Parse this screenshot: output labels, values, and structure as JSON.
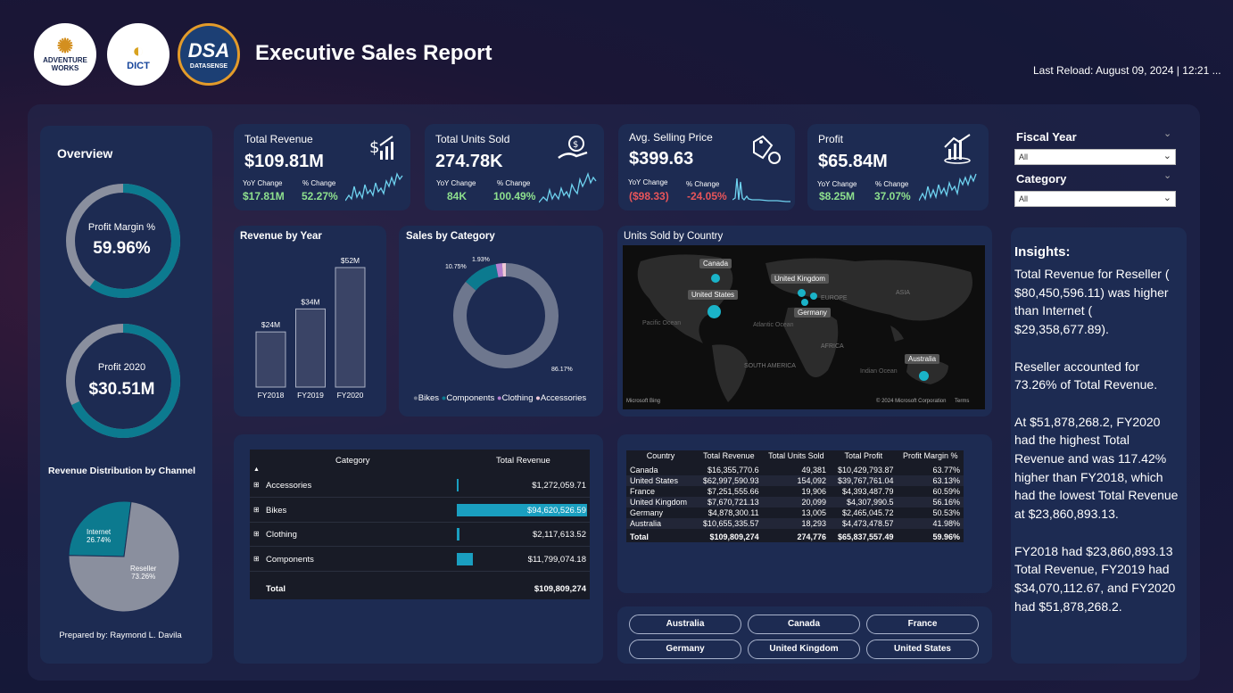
{
  "header": {
    "title": "Executive Sales Report",
    "last_reload": "Last Reload: August 09, 2024 | 12:21 ...",
    "logos": [
      {
        "name": "ADVENTURE WORKS",
        "line1": "ADVENTURE",
        "line2": "WORKS"
      },
      {
        "name": "DICT",
        "text": "DICT"
      },
      {
        "name": "DATASENSE",
        "big": "DSA",
        "small": "DATASENSE"
      }
    ]
  },
  "overview": {
    "title": "Overview",
    "profit_margin": {
      "label": "Profit Margin %",
      "value": "59.96%",
      "fraction": 0.5996
    },
    "profit_2020": {
      "label": "Profit 2020",
      "value": "$30.51M",
      "fraction": 0.68
    },
    "channel_title": "Revenue Distribution by Channel",
    "channels": [
      {
        "name": "Internet",
        "pct": "26.74%",
        "value": 26.74
      },
      {
        "name": "Reseller",
        "pct": "73.26%",
        "value": 73.26
      }
    ],
    "prepared_by": "Prepared by: Raymond L. Davila"
  },
  "kpis": [
    {
      "title": "Total Revenue",
      "value": "$109.81M",
      "sub1": "YoY Change",
      "sub2": "% Change",
      "num1": "$17.81M",
      "num2": "52.27%",
      "tone": "green",
      "icon": "revenue-icon"
    },
    {
      "title": "Total Units Sold",
      "value": "274.78K",
      "sub1": "YoY Change",
      "sub2": "% Change",
      "num1": "84K",
      "num2": "100.49%",
      "tone": "green",
      "icon": "units-icon"
    },
    {
      "title": "Avg. Selling Price",
      "value": "$399.63",
      "sub1": "YoY Change",
      "sub2": "% Change",
      "num1": "($98.33)",
      "num2": "-24.05%",
      "tone": "red",
      "icon": "price-tag-icon"
    },
    {
      "title": "Profit",
      "value": "$65.84M",
      "sub1": "YoY Change",
      "sub2": "% Change",
      "num1": "$8.25M",
      "num2": "37.07%",
      "tone": "green",
      "icon": "profit-icon"
    }
  ],
  "filters": {
    "fiscal_year": {
      "label": "Fiscal Year",
      "value": "All"
    },
    "category": {
      "label": "Category",
      "value": "All"
    }
  },
  "revenue_by_year": {
    "title": "Revenue by Year",
    "bars": [
      {
        "year": "FY2018",
        "label": "$24M",
        "value": 24
      },
      {
        "year": "FY2019",
        "label": "$34M",
        "value": 34
      },
      {
        "year": "FY2020",
        "label": "$52M",
        "value": 52
      }
    ]
  },
  "sales_by_category": {
    "title": "Sales by Category",
    "slices": [
      {
        "name": "Bikes",
        "value": 86.17,
        "label": "86.17%",
        "color": "#6e778e"
      },
      {
        "name": "Components",
        "value": 10.75,
        "label": "10.75%",
        "color": "#0c7a8f"
      },
      {
        "name": "Clothing",
        "value": 1.93,
        "label": "1.93%",
        "color": "#b57fcf"
      },
      {
        "name": "Accessories",
        "value": 1.15,
        "label": "",
        "color": "#f0c9d7"
      }
    ]
  },
  "map": {
    "title": "Units Sold by Country",
    "labels": {
      "canada": "Canada",
      "united_states": "United States",
      "united_kingdom": "United Kingdom",
      "germany": "Germany",
      "australia": "Australia",
      "europe": "EUROPE",
      "asia": "ASIA",
      "africa": "AFRICA",
      "south_america": "SOUTH AMERICA",
      "pacific": "Pacific Ocean",
      "atlantic": "Atlantic Ocean",
      "indian": "Indian Ocean"
    },
    "credit_left": "Microsoft Bing",
    "credit_right": "© 2024 Microsoft Corporation",
    "terms": "Terms"
  },
  "category_table": {
    "sort_indicator": "▲",
    "headers": [
      "Category",
      "Total Revenue"
    ],
    "rows": [
      {
        "name": "Accessories",
        "value": "$1,272,059.71",
        "share": 0.01344
      },
      {
        "name": "Bikes",
        "value": "$94,620,526.59",
        "share": 1.0
      },
      {
        "name": "Clothing",
        "value": "$2,117,613.52",
        "share": 0.02238
      },
      {
        "name": "Components",
        "value": "$11,799,074.18",
        "share": 0.1247
      }
    ],
    "total_label": "Total",
    "total_value": "$109,809,274"
  },
  "country_table": {
    "headers": [
      "Country",
      "Total Revenue",
      "Total Units Sold",
      "Total Profit",
      "Profit Margin %"
    ],
    "rows": [
      [
        "Canada",
        "$16,355,770.6",
        "49,381",
        "$10,429,793.87",
        "63.77%"
      ],
      [
        "United States",
        "$62,997,590.93",
        "154,092",
        "$39,767,761.04",
        "63.13%"
      ],
      [
        "France",
        "$7,251,555.66",
        "19,906",
        "$4,393,487.79",
        "60.59%"
      ],
      [
        "United Kingdom",
        "$7,670,721.13",
        "20,099",
        "$4,307,990.5",
        "56.16%"
      ],
      [
        "Germany",
        "$4,878,300.11",
        "13,005",
        "$2,465,045.72",
        "50.53%"
      ],
      [
        "Australia",
        "$10,655,335.57",
        "18,293",
        "$4,473,478.57",
        "41.98%"
      ]
    ],
    "total": [
      "Total",
      "$109,809,274",
      "274,776",
      "$65,837,557.49",
      "59.96%"
    ]
  },
  "country_buttons": [
    "Australia",
    "Canada",
    "France",
    "Germany",
    "United Kingdom",
    "United States"
  ],
  "insights": {
    "title": "Insights:",
    "paragraphs": [
      "Total Revenue for Reseller ( $80,450,596.11) was higher than Internet ( $29,358,677.89).",
      "Reseller accounted for 73.26% of Total Revenue.",
      "At $51,878,268.2, FY2020 had the highest Total Revenue and was 117.42% higher than FY2018, which had the lowest Total Revenue at $23,860,893.13.",
      "FY2018 had $23,860,893.13 Total Revenue, FY2019 had $34,070,112.67, and FY2020 had $51,878,268.2."
    ]
  },
  "colors": {
    "panel": "#1d2b52",
    "teal": "#0c7a8f",
    "grey": "#8a8f9e",
    "bar": "#1a9fc0"
  }
}
